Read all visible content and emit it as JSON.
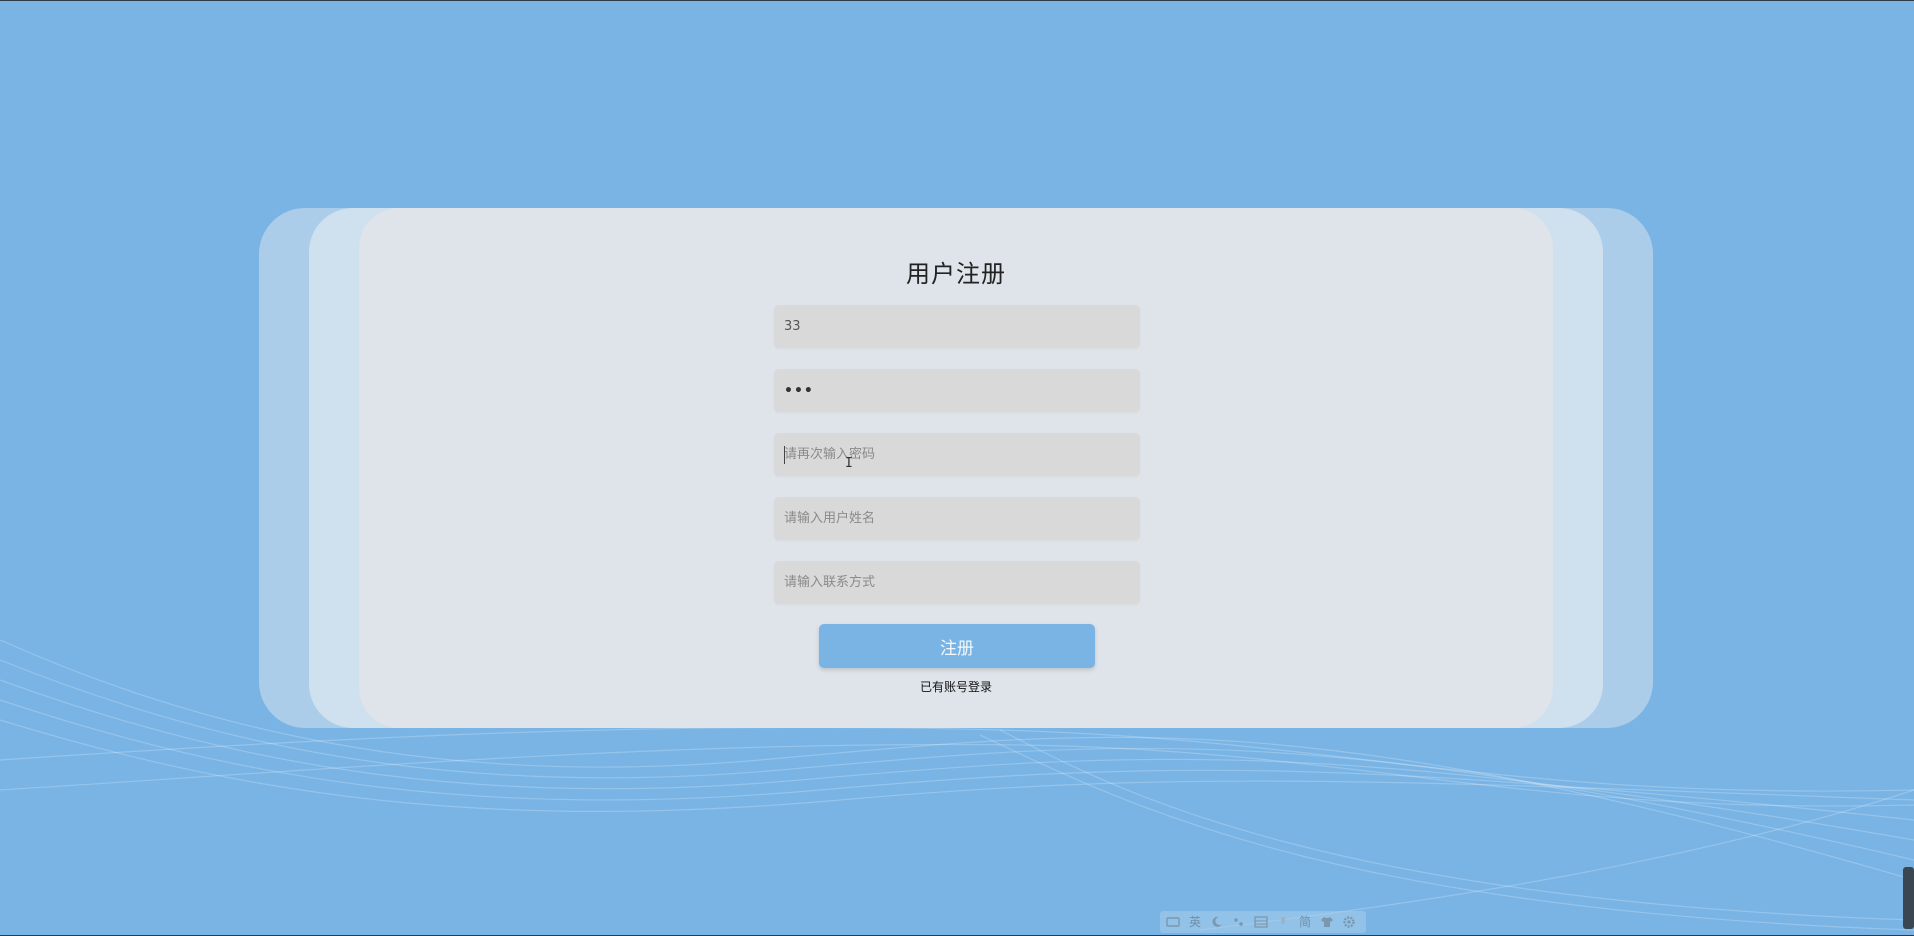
{
  "form": {
    "title": "用户注册",
    "fields": [
      {
        "value": "33",
        "placeholder": ""
      },
      {
        "value": "•••",
        "placeholder": ""
      },
      {
        "value": "",
        "placeholder": "请再次输入密码"
      },
      {
        "value": "",
        "placeholder": "请输入用户姓名"
      },
      {
        "value": "",
        "placeholder": "请输入联系方式"
      }
    ],
    "submit_label": "注册",
    "login_link": "已有账号登录"
  },
  "tray": {
    "icons": [
      "keyboard-icon",
      "ime-english-icon",
      "moon-icon",
      "punctuation-icon",
      "table-icon",
      "mic-icon",
      "simplified-icon",
      "shirt-icon",
      "gear-icon"
    ],
    "ime_label": "英",
    "simplified_label": "简"
  },
  "colors": {
    "background": "#79b4e5",
    "card": "#dee4ea",
    "input": "#d9d9d9",
    "button": "#79b4e5"
  }
}
